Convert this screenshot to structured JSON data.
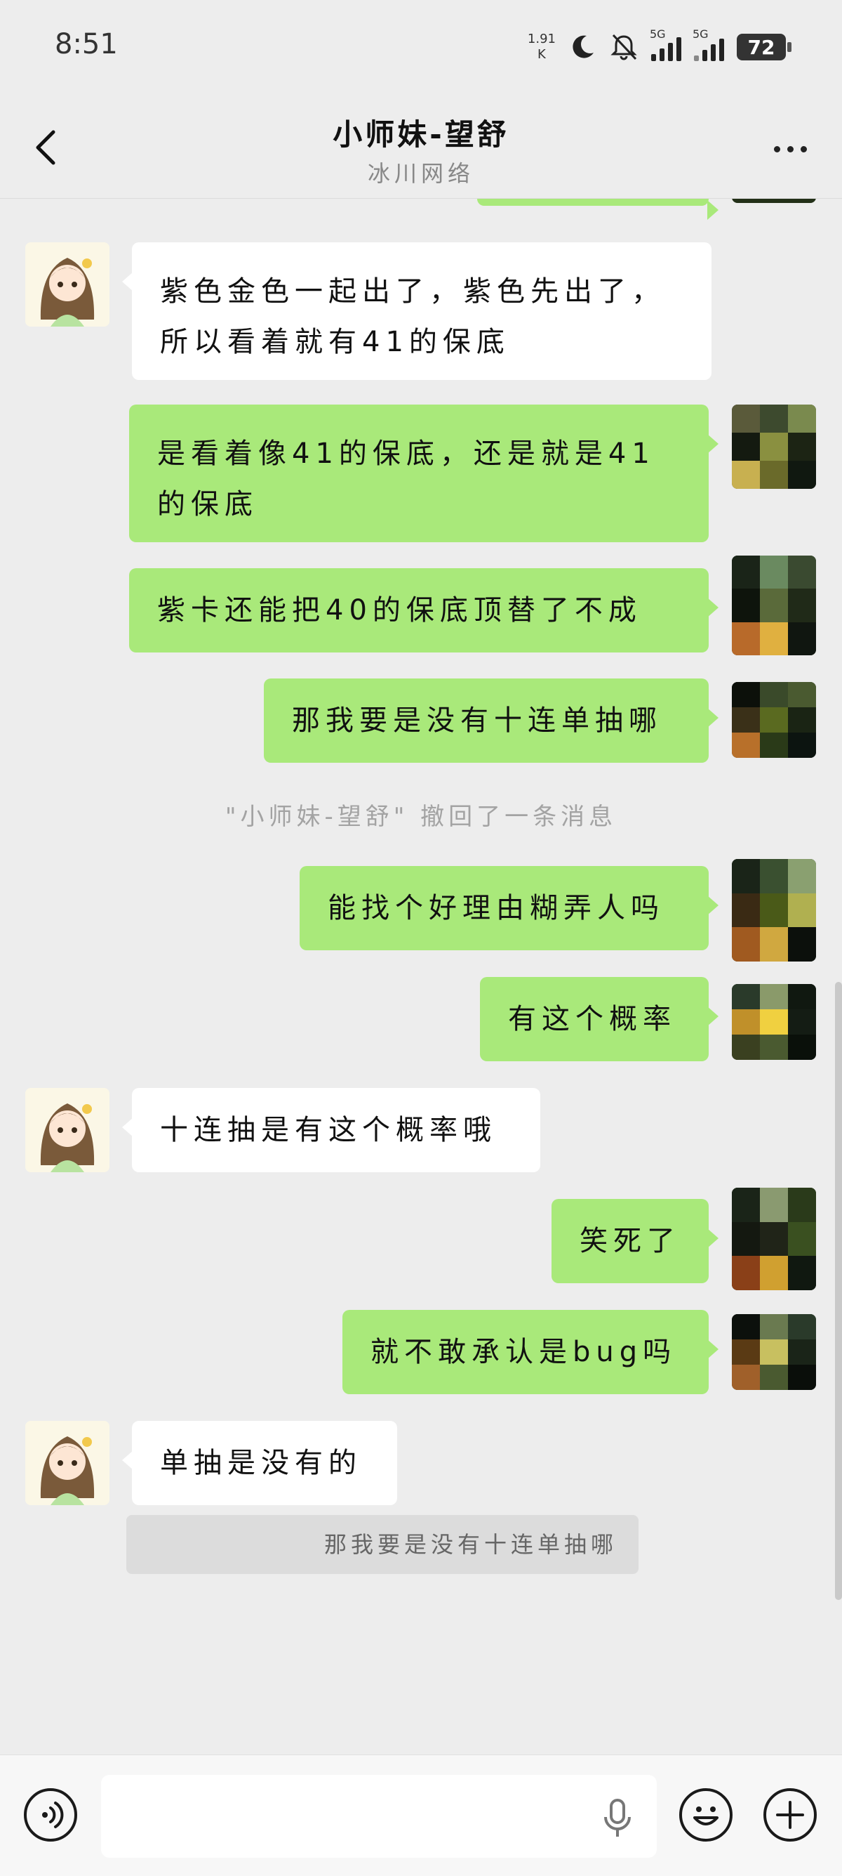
{
  "status_bar": {
    "time": "8:51",
    "net_speed_value": "1.91",
    "net_speed_unit": "K",
    "sim1_tag": "5G",
    "sim2_tag": "5G",
    "battery": "72"
  },
  "header": {
    "title": "小师妹-望舒",
    "subtitle": "冰川网络"
  },
  "messages": [
    {
      "side": "left",
      "text": "紫色金色一起出了，紫色先出了，所以看着就有41的保底"
    },
    {
      "side": "right",
      "text": "是看着像41的保底，还是就是41的保底"
    },
    {
      "side": "right",
      "text": "紫卡还能把40的保底顶替了不成"
    },
    {
      "side": "right",
      "text": "那我要是没有十连单抽哪"
    },
    {
      "side": "notice",
      "text": "\"小师妹-望舒\" 撤回了一条消息"
    },
    {
      "side": "right",
      "text": "能找个好理由糊弄人吗"
    },
    {
      "side": "right",
      "text": "有这个概率"
    },
    {
      "side": "left",
      "text": "十连抽是有这个概率哦"
    },
    {
      "side": "right",
      "text": "笑死了"
    },
    {
      "side": "right",
      "text": "就不敢承认是bug吗"
    },
    {
      "side": "left",
      "text": "单抽是没有的"
    }
  ],
  "quoted_message": "那我要是没有十连单抽哪",
  "colors": {
    "self_bubble": "#a9e97a",
    "other_bubble": "#ffffff",
    "background": "#ededed"
  },
  "icons": {
    "back": "chevron-left-icon",
    "more": "more-dots-icon",
    "voice": "voice-icon",
    "mic": "mic-icon",
    "emoji": "emoji-icon",
    "plus": "plus-icon"
  }
}
